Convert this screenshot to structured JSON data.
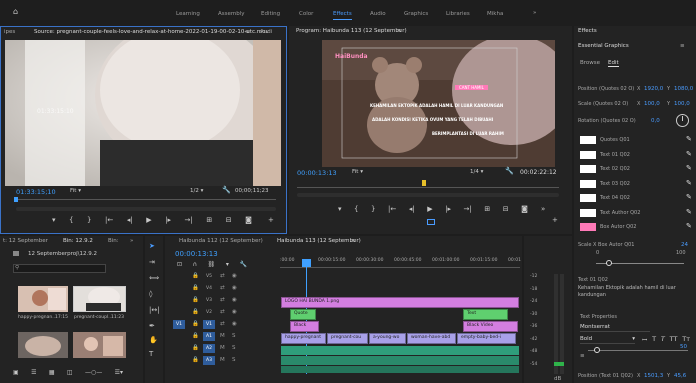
{
  "workspace": {
    "tabs": [
      "Learning",
      "Assembly",
      "Editing",
      "Color",
      "Effects",
      "Audio",
      "Graphics",
      "Libraries",
      "Mikha"
    ],
    "active": "Effects",
    "more": "»"
  },
  "source": {
    "left_tab": "ipes",
    "title": "Source: pregnant-couple-feels-love-and-relax-at-home-2022-01-19-00-02-10-utc.mov",
    "menu": "≡",
    "extra_tab": "Audi",
    "overlay_tc": "01:33:15:10",
    "timecode": "01:33:15;10",
    "fit": "Fit",
    "res": "1/2",
    "duration": "00;00;11;23"
  },
  "program": {
    "title": "Program: Haibunda 113 (12 September)",
    "menu": "≡",
    "logo_text": "HaiBunda",
    "badge": "CANT HAMIL",
    "lines": [
      "KEHAMILAN EKTOPIK ADALAH HAMIL DI LUAR KANDUNGAN",
      "ADALAH KONDISI KETIKA OVUM YANG TELAH DIBUAHI",
      "BERIMPLANTASI DI LUAR RAHIM"
    ],
    "timecode": "00:00:13:13",
    "fit": "Fit",
    "res": "1/4",
    "duration": "00:02:22:12"
  },
  "project": {
    "tab1": "t: 12 September",
    "tab2": "Bin: 12.9.2",
    "tab3": "Bin:",
    "more": "»",
    "folder": "12 Septemberproj\\12.9.2",
    "thumbs": [
      {
        "label": "happy-pregnan...",
        "dur": "17:15"
      },
      {
        "label": "pregnant-coupl...",
        "dur": "11:23"
      },
      {
        "label": "",
        "dur": ""
      },
      {
        "label": "",
        "dur": ""
      }
    ]
  },
  "timeline": {
    "tab1": "Haibunda 112 (12 September)",
    "tab2": "Haibunda 113 (12 September)",
    "menu": "≡",
    "timecode": "00:00:13:13",
    "ruler": [
      ":00:00",
      "00:00:15:00",
      "00:00:30:00",
      "00:00:45:00",
      "00:01:00:00",
      "00:01:15:00",
      "00:01"
    ],
    "video_tracks": [
      "V5",
      "V4",
      "V3",
      "V2",
      "V1"
    ],
    "audio_tracks": [
      "A1",
      "A2",
      "A3"
    ],
    "src_label": "V1",
    "clips": {
      "v4": "LOGO HAI BUNDA 1.png",
      "v3a": "Quote",
      "v3b": "Text",
      "v2a": "Black",
      "v2b": "Black Video",
      "v1": [
        "happy-pregnant",
        "pregnant-cou",
        "a-young-wo",
        "woman-have-abd",
        "empty-baby-bed-i"
      ]
    }
  },
  "meter": {
    "ticks": [
      "-12",
      "-18",
      "-24",
      "-30",
      "-36",
      "-42",
      "-48",
      "-54"
    ],
    "unit": "dB"
  },
  "effects": {
    "panel": "Effects",
    "section": "Essential Graphics",
    "tab_browse": "Browse",
    "tab_edit": "Edit",
    "pos_label": "Position (Quotes 02 O)",
    "pos_x_l": "X",
    "pos_x": "1920,0",
    "pos_y_l": "Y",
    "pos_y": "1080,0",
    "scale_label": "Scale (Quotes 02 O)",
    "scale_x_l": "X",
    "scale_x": "100,0",
    "scale_y_l": "Y",
    "scale_y": "100,0",
    "rot_label": "Rotation (Quotes 02 O)",
    "rot_val": "0,0",
    "layers": [
      "Quotes Q01",
      "Text 01 Q02",
      "Text 02 Q02",
      "Text 03 Q02",
      "Text 04 Q02",
      "Text Author Q02",
      "Box Autor Q02"
    ],
    "scaleX_label": "Scale X Box Autor Q01",
    "scaleX_val": "24",
    "scaleX_min": "0",
    "scaleX_max": "100",
    "text_label": "Text 01 Q02",
    "text_val": "Kehamilan Ektopik adalah hamil di luar kandungan",
    "props_title": "Text Properties",
    "font": "Montserrat",
    "weight": "Bold",
    "size_val": "50",
    "pos2_label": "Position (Text 01 Q02)",
    "pos2_x": "1501,3",
    "pos2_y": "45,6"
  },
  "colors": {
    "accent": "#4a9cff",
    "timecode": "#3fa0ff",
    "clip_pink": "#d37ee0",
    "clip_green": "#5fcf6f",
    "clip_v1": "#a8a0e8",
    "audio": "#2f9e7b",
    "box_pink": "#ff7ab8"
  }
}
